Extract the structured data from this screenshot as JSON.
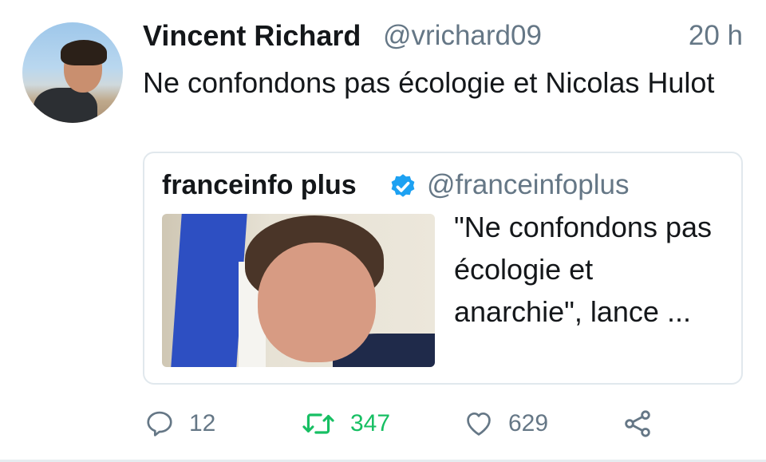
{
  "tweet": {
    "author_name": "Vincent Richard",
    "author_handle": "@vrichard09",
    "time": "20 h",
    "text": "Ne confondons pas écologie et Nicolas Hulot"
  },
  "quoted": {
    "author_name": "franceinfo plus",
    "verified_icon": "verified-badge-icon",
    "author_handle": "@franceinfoplus",
    "text": "\"Ne confondons pas écologie et anarchie\", lance ..."
  },
  "actions": {
    "replies": "12",
    "retweets": "347",
    "likes": "629"
  },
  "icons": {
    "reply": "comment-bubble-icon",
    "retweet": "retweet-icon",
    "like": "heart-icon",
    "share": "share-icon"
  },
  "colors": {
    "text": "#14171a",
    "secondary": "#657786",
    "retweet_active": "#17bf63",
    "verified": "#1da1f2",
    "border": "#e1e8ed"
  }
}
